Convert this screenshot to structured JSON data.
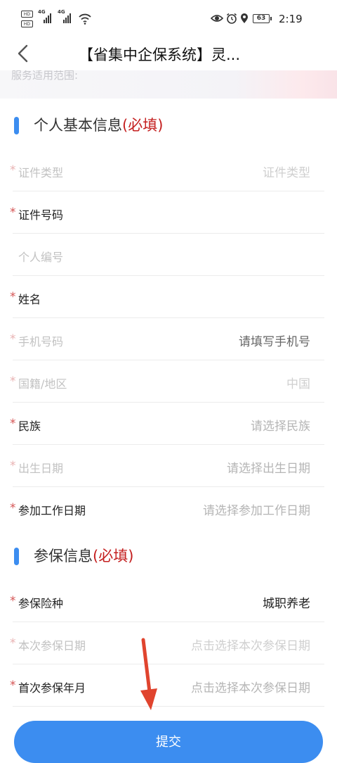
{
  "status_bar": {
    "hd1": "HD",
    "hd2": "HD",
    "net1": "4G",
    "net2": "4G",
    "battery": "63",
    "time": "2:19"
  },
  "nav": {
    "title": "【省集中企保系统】灵..."
  },
  "banner": {
    "text": "服务适用范围:"
  },
  "sections": {
    "personal": {
      "title": "个人基本信息",
      "required": "(必填)"
    },
    "insurance": {
      "title": "参保信息",
      "required": "(必填)"
    }
  },
  "personal_rows": [
    {
      "star": "*",
      "label": "证件类型",
      "value": "证件类型"
    },
    {
      "star": "*",
      "label": "证件号码",
      "value": ""
    },
    {
      "star": "",
      "label": "个人编号",
      "value": ""
    },
    {
      "star": "*",
      "label": "姓名",
      "value": ""
    },
    {
      "star": "*",
      "label": "手机号码",
      "value": "请填写手机号"
    },
    {
      "star": "*",
      "label": "国籍/地区",
      "value": "中国"
    },
    {
      "star": "*",
      "label": "民族",
      "value": "请选择民族"
    },
    {
      "star": "*",
      "label": "出生日期",
      "value": "请选择出生日期"
    },
    {
      "star": "*",
      "label": "参加工作日期",
      "value": "请选择参加工作日期"
    }
  ],
  "insurance_rows": [
    {
      "star": "*",
      "label": "参保险种",
      "value": "城职养老"
    },
    {
      "star": "*",
      "label": "本次参保日期",
      "value": "点击选择本次参保日期"
    },
    {
      "star": "*",
      "label": "首次参保年月",
      "value": "点击选择本次参保日期"
    }
  ],
  "submit": {
    "label": "提交"
  },
  "colors": {
    "accent": "#3c8df0",
    "required_red": "#c41f1f",
    "annotation_arrow": "#e0442e"
  }
}
